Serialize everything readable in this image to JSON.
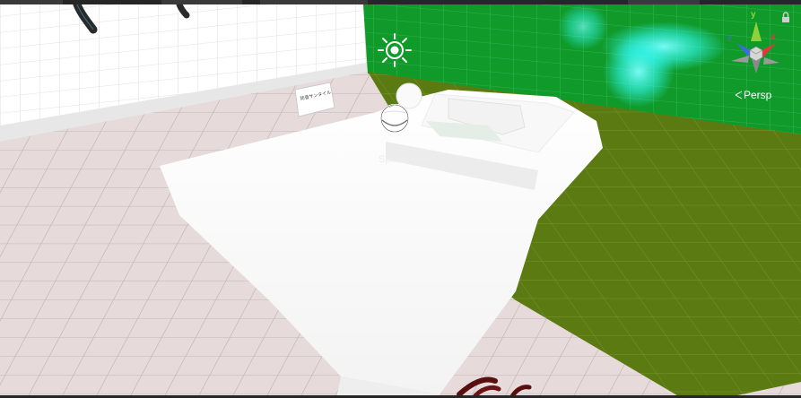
{
  "scene_view": {
    "gizmo": {
      "axis_y": "y",
      "axis_x": "x",
      "axis_z": "z",
      "lock_icon": "lock-icon",
      "projection_label": "Persp",
      "projection_icon": "perspective-lines-icon"
    },
    "spawn_point": {
      "label": "Spawn Point",
      "icon": "sphere-gizmo-icon"
    },
    "directional_light_icon": "sun-icon",
    "sign_text": "防音サンタイル",
    "colors": {
      "green_wall": "#0f9a2a",
      "olive_floor": "#5c7a12",
      "tile_floor": "#e6dada",
      "white_wall": "#ffffff",
      "cyan_glow": "#33ffff",
      "axis_y": "#8fd13a",
      "axis_x": "#e0373a",
      "axis_z": "#3a6ee0"
    }
  }
}
